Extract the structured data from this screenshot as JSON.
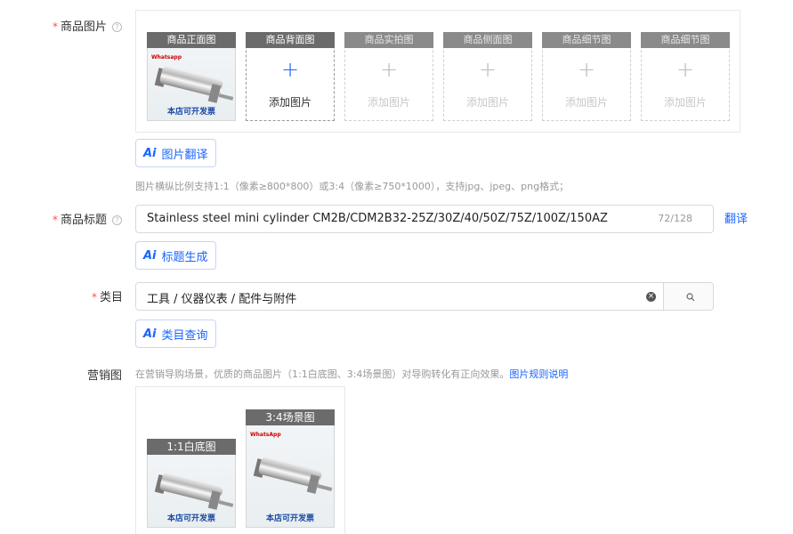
{
  "product_images": {
    "label": "商品图片",
    "slots": [
      {
        "title": "商品正面图",
        "has_image": true,
        "watermark": "本店可开发票"
      },
      {
        "title": "商品背面图",
        "add_label": "添加图片"
      },
      {
        "title": "商品实拍图",
        "add_label": "添加图片"
      },
      {
        "title": "商品侧面图",
        "add_label": "添加图片"
      },
      {
        "title": "商品细节图",
        "add_label": "添加图片"
      },
      {
        "title": "商品细节图",
        "add_label": "添加图片"
      }
    ],
    "ai_button": "图片翻译",
    "hint": "图片横纵比例支持1:1（像素≥800*800）或3:4（像素≥750*1000），支持jpg、jpeg、png格式；"
  },
  "title_field": {
    "label": "商品标题",
    "value": "Stainless steel mini cylinder CM2B/CDM2B32-25Z/30Z/40/50Z/75Z/100Z/150AZ",
    "count": "72/128",
    "translate": "翻译",
    "ai_button": "标题生成"
  },
  "category_field": {
    "label": "类目",
    "value": "工具 / 仪器仪表 / 配件与附件",
    "ai_button": "类目查询"
  },
  "marketing": {
    "label": "营销图",
    "hint": "在营销导购场景，优质的商品图片（1:1白底图、3:4场景图）对导购转化有正向效果。",
    "rule_link": "图片规则说明",
    "slots": [
      {
        "title": "1:1白底图",
        "watermark": "本店可开发票"
      },
      {
        "title": "3:4场景图",
        "watermark": "本店可开发票"
      }
    ]
  },
  "colors": {
    "accent": "#1a66ff",
    "required": "#ff4d4f",
    "slot_header": "#6b6b6b"
  }
}
